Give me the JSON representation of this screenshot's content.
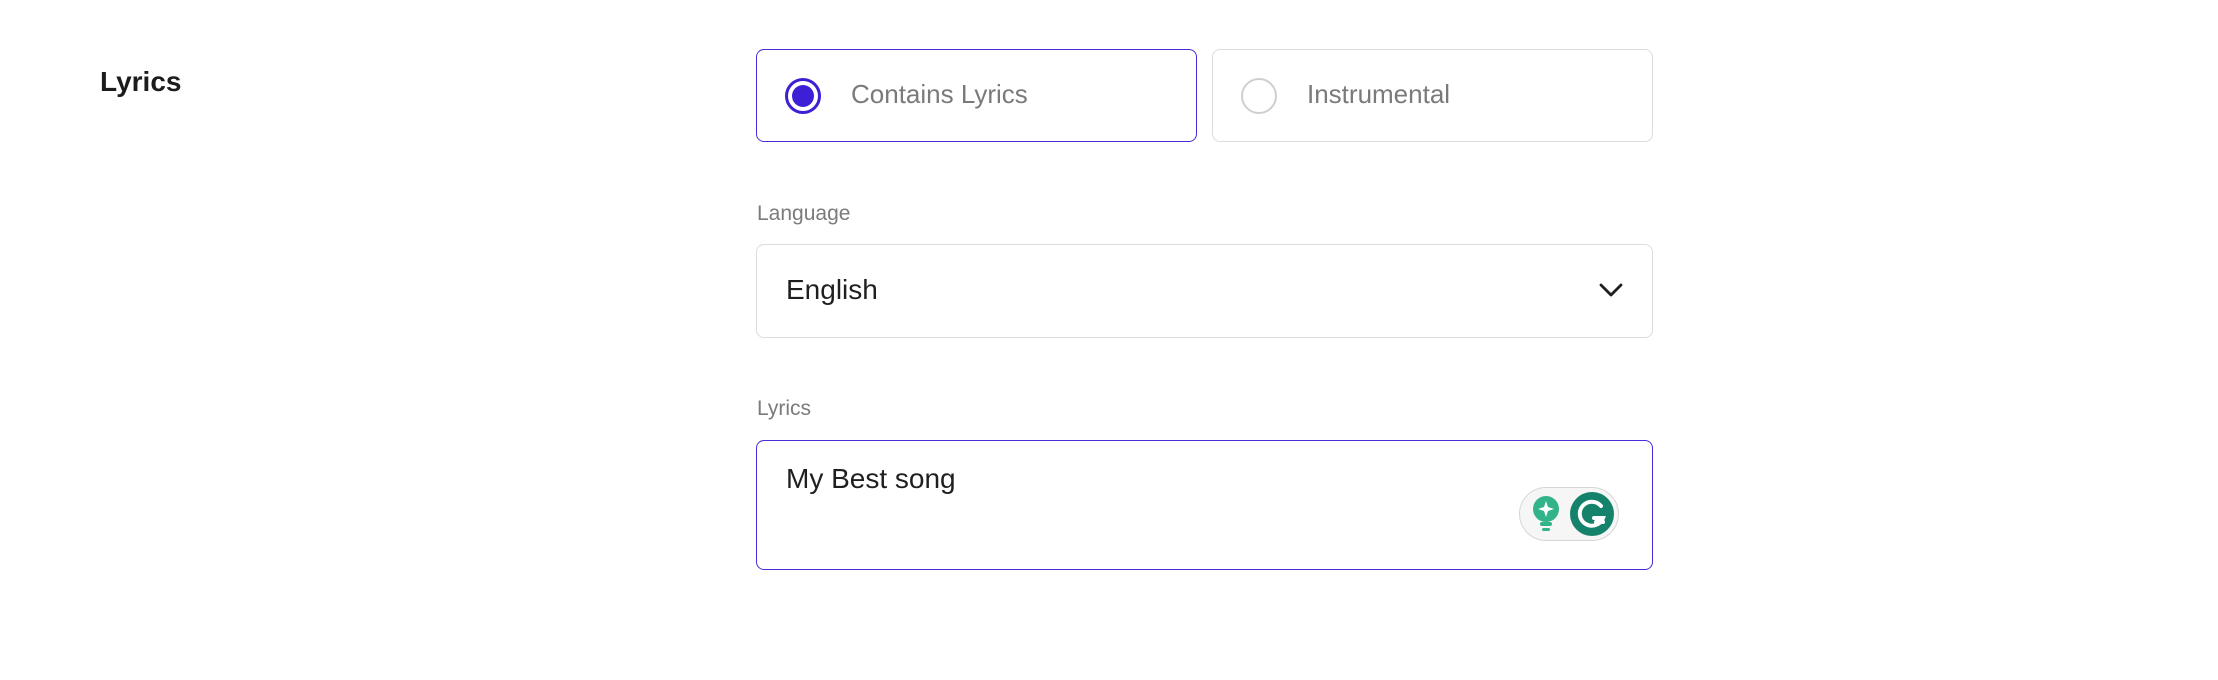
{
  "section": {
    "title": "Lyrics"
  },
  "lyrics_type": {
    "options": [
      {
        "label": "Contains Lyrics",
        "selected": true
      },
      {
        "label": "Instrumental",
        "selected": false
      }
    ]
  },
  "language": {
    "label": "Language",
    "value": "English"
  },
  "lyrics": {
    "label": "Lyrics",
    "value": "My Best song"
  },
  "colors": {
    "accent": "#3d1fd6",
    "border": "#dcdcdc",
    "label_text": "#7b7b7b",
    "grammarly_green": "#15826b"
  },
  "icons": {
    "dropdown": "chevron-down-icon",
    "grammarly_suggest": "lightbulb-icon",
    "grammarly_logo": "grammarly-g-icon"
  }
}
